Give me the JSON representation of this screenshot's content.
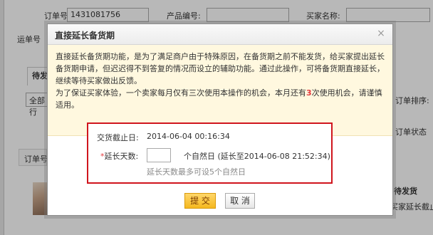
{
  "background": {
    "order_no_label": "订单号:",
    "order_no_value": "1431081756",
    "product_no_label": "产品编号:",
    "buyer_name_label": "买家名称:",
    "waybill_label": "运单号",
    "tab_label": "待发",
    "all_select_label": "全部行",
    "sort_label": "订单排序:",
    "order_status_label": "订单状态",
    "order_no_col_label": "订单号",
    "pending_label": "待发货",
    "extend_label": "买家延长截止日"
  },
  "dialog": {
    "title": "直接延长备货期",
    "close_glyph": "×",
    "notice_line1": "直接延长备货期功能，是为了满足商户由于特殊原因，在备货期之前不能发货，给买家提出延长备货期申请，但迟迟得不到答复的情况而设立的辅助功能。通过此操作，可将备货期直接延长，继续等待买家做出反馈。",
    "notice_line2_before": "为了保证买家体验，一个卖家每月仅有三次使用本操作的机会，本月还有",
    "notice_count": "3",
    "notice_line2_after": "次使用机会，请谨慎适用。",
    "deadline_label": "交货截止日:",
    "deadline_value": "2014-06-04 00:16:34",
    "star": "*",
    "days_label": "延长天数:",
    "days_input_value": "",
    "days_unit": "个自然日 (延长至2014-06-08 21:52:34)",
    "days_hint": "延长天数最多可设5个自然日",
    "submit_label": "提 交",
    "cancel_label": "取 消"
  },
  "colors": {
    "highlight_red": "#e4393c",
    "frame_red": "#d0151d",
    "notice_bg": "#fff8df",
    "submit_yellow": "#f5b81e"
  }
}
